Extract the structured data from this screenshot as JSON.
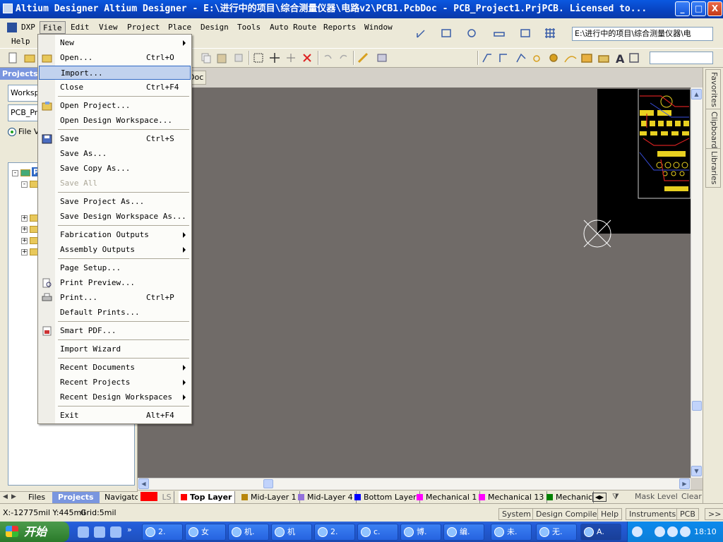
{
  "window": {
    "title": "Altium Designer Altium Designer - E:\\进行中的项目\\综合测量仪器\\电路v2\\PCB1.PcbDoc - PCB_Project1.PrjPCB. Licensed to...",
    "minimize": "_",
    "maximize": "□",
    "close": "X"
  },
  "menubar": {
    "dxp": "DXP",
    "items": [
      "File",
      "Edit",
      "View",
      "Project",
      "Place",
      "Design",
      "Tools",
      "Auto Route",
      "Reports",
      "Window"
    ],
    "help": "Help"
  },
  "toolbar": {
    "path": "E:\\进行中的项目\\综合测量仪器\\电"
  },
  "projects_panel": {
    "title": "Projects",
    "workspace_field": "Worksp",
    "project_field": "PCB_Pr",
    "radio_label": "File V",
    "tree_root_label": "P"
  },
  "document_tab": {
    "label": "Doc"
  },
  "file_menu": {
    "items": [
      {
        "label": "New",
        "shortcut": "",
        "submenu": true,
        "icon": ""
      },
      {
        "label": "Open...",
        "shortcut": "Ctrl+O",
        "submenu": false,
        "icon": "folder-open-icon"
      },
      {
        "label": "Import...",
        "shortcut": "",
        "submenu": false,
        "icon": "",
        "highlighted": true
      },
      {
        "label": "Close",
        "shortcut": "Ctrl+F4",
        "submenu": false,
        "icon": ""
      },
      {
        "label": "Open Project...",
        "shortcut": "",
        "submenu": false,
        "icon": "open-project-icon"
      },
      {
        "label": "Open Design Workspace...",
        "shortcut": "",
        "submenu": false,
        "icon": ""
      },
      {
        "label": "Save",
        "shortcut": "Ctrl+S",
        "submenu": false,
        "icon": "save-icon"
      },
      {
        "label": "Save As...",
        "shortcut": "",
        "submenu": false,
        "icon": ""
      },
      {
        "label": "Save Copy As...",
        "shortcut": "",
        "submenu": false,
        "icon": ""
      },
      {
        "label": "Save All",
        "shortcut": "",
        "submenu": false,
        "icon": "",
        "disabled": true
      },
      {
        "label": "Save Project As...",
        "shortcut": "",
        "submenu": false,
        "icon": ""
      },
      {
        "label": "Save Design Workspace As...",
        "shortcut": "",
        "submenu": false,
        "icon": ""
      },
      {
        "label": "Fabrication Outputs",
        "shortcut": "",
        "submenu": true,
        "icon": ""
      },
      {
        "label": "Assembly Outputs",
        "shortcut": "",
        "submenu": true,
        "icon": ""
      },
      {
        "label": "Page Setup...",
        "shortcut": "",
        "submenu": false,
        "icon": ""
      },
      {
        "label": "Print Preview...",
        "shortcut": "",
        "submenu": false,
        "icon": "print-preview-icon"
      },
      {
        "label": "Print...",
        "shortcut": "Ctrl+P",
        "submenu": false,
        "icon": "printer-icon"
      },
      {
        "label": "Default Prints...",
        "shortcut": "",
        "submenu": false,
        "icon": ""
      },
      {
        "label": "Smart PDF...",
        "shortcut": "",
        "submenu": false,
        "icon": "smart-pdf-icon"
      },
      {
        "label": "Import Wizard",
        "shortcut": "",
        "submenu": false,
        "icon": ""
      },
      {
        "label": "Recent Documents",
        "shortcut": "",
        "submenu": true,
        "icon": ""
      },
      {
        "label": "Recent Projects",
        "shortcut": "",
        "submenu": true,
        "icon": ""
      },
      {
        "label": "Recent Design Workspaces",
        "shortcut": "",
        "submenu": true,
        "icon": ""
      },
      {
        "label": "Exit",
        "shortcut": "Alt+F4",
        "submenu": false,
        "icon": ""
      }
    ]
  },
  "right_panel": {
    "tabs": [
      "Favorites",
      "Clipboard",
      "Libraries"
    ]
  },
  "bottom_panel_tabs": [
    "Files",
    "Projects",
    "Navigato"
  ],
  "layer_tabs": {
    "current_swatch": "LS",
    "layers": [
      {
        "name": "Top Layer",
        "color": "#ff0000",
        "active": true
      },
      {
        "name": "Mid-Layer 1",
        "color": "#b8860b"
      },
      {
        "name": "Mid-Layer 4",
        "color": "#9370db"
      },
      {
        "name": "Bottom Layer",
        "color": "#0000ff"
      },
      {
        "name": "Mechanical 1",
        "color": "#ff00ff"
      },
      {
        "name": "Mechanical 13",
        "color": "#ff00ff"
      },
      {
        "name": "Mechanic",
        "color": "#008000"
      }
    ],
    "mask_level": "Mask Level",
    "clear": "Clear"
  },
  "statusbar": {
    "coords": "X:-12775mil Y:445mil",
    "grid": "Grid:5mil",
    "buttons": [
      "System",
      "Design Compiler",
      "Help",
      "Instruments",
      "PCB",
      ">>"
    ]
  },
  "taskbar": {
    "start": "开始",
    "tasks": [
      "2.",
      "女",
      "机.",
      "机",
      "2.",
      "c.",
      "博.",
      "编.",
      "未.",
      "无.",
      "A."
    ],
    "clock": "18:10"
  }
}
